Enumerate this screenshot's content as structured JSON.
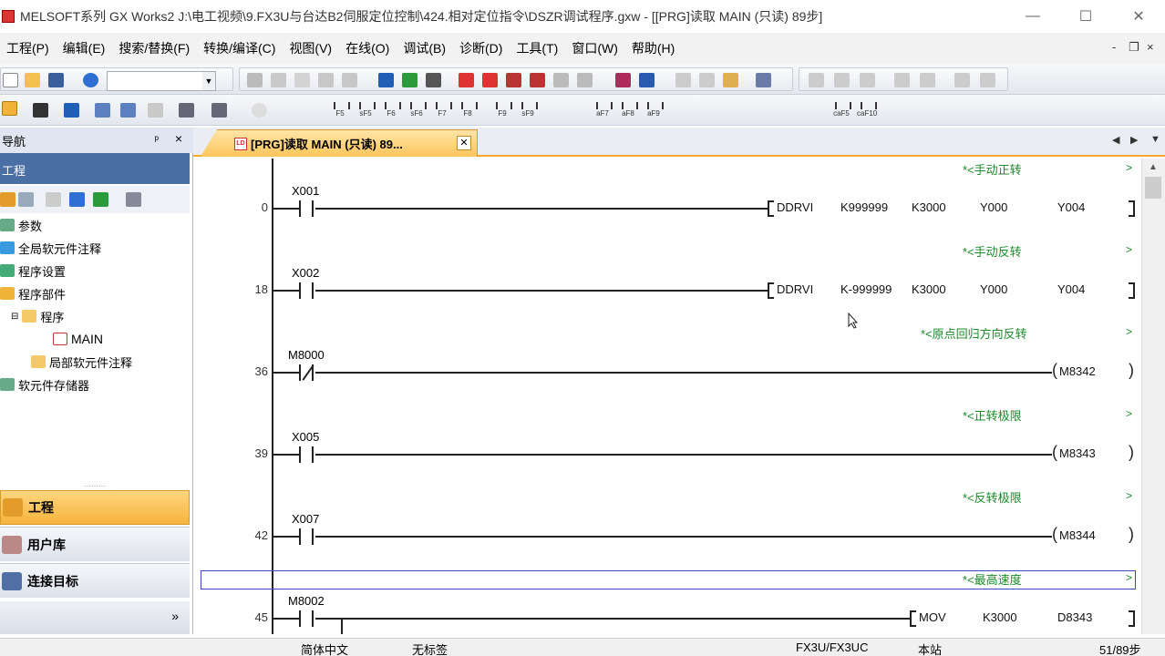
{
  "window": {
    "title": "MELSOFT系列 GX Works2 J:\\电工视频\\9.FX3U与台达B2伺服定位控制\\424.相对定位指令\\DSZR调试程序.gxw - [[PRG]读取 MAIN (只读) 89步]",
    "minimize": "—",
    "maximize": "☐",
    "close": "✕"
  },
  "menu": {
    "items": [
      "工程(P)",
      "编辑(E)",
      "搜索/替换(F)",
      "转换/编译(C)",
      "视图(V)",
      "在线(O)",
      "调试(B)",
      "诊断(D)",
      "工具(T)",
      "窗口(W)",
      "帮助(H)"
    ],
    "mdi_minimize": "-",
    "mdi_restore": "❐",
    "mdi_close": "×"
  },
  "toolbar": {
    "combo_value": "",
    "fkeys": [
      "F5",
      "sF5",
      "F6",
      "sF6",
      "F7",
      "F8",
      "F9",
      "sF9",
      "aF7",
      "aF8",
      "aF9",
      "caF5",
      "caF10"
    ]
  },
  "nav": {
    "header": "导航",
    "pin": "ᵖ",
    "close": "×",
    "section": "工程",
    "tree": [
      {
        "label": "参数",
        "level": 0
      },
      {
        "label": "全局软元件注释",
        "level": 0
      },
      {
        "label": "程序设置",
        "level": 0
      },
      {
        "label": "程序部件",
        "level": 0
      },
      {
        "label": "程序",
        "level": 1
      },
      {
        "label": "MAIN",
        "level": 2
      },
      {
        "label": "局部软元件注释",
        "level": 1
      },
      {
        "label": "软元件存储器",
        "level": 0
      }
    ],
    "buttons": [
      {
        "label": "工程",
        "active": true
      },
      {
        "label": "用户库",
        "active": false
      },
      {
        "label": "连接目标",
        "active": false
      }
    ],
    "bottom": "»",
    "splitter": "·········"
  },
  "tabs": {
    "active_label": "[PRG]读取 MAIN (只读) 89...",
    "close": "✕",
    "prev": "◀",
    "next": "▶",
    "menu": "▼"
  },
  "ladder": {
    "rungs": [
      {
        "step": "0",
        "comment": "*<手动正转",
        "contact": "X001",
        "contact_type": "NO",
        "output": "instruction",
        "instruction": "DDRVI",
        "operands": [
          "K999999",
          "K3000",
          "Y000",
          "Y004"
        ]
      },
      {
        "step": "18",
        "comment": "*<手动反转",
        "contact": "X002",
        "contact_type": "NO",
        "output": "instruction",
        "instruction": "DDRVI",
        "operands": [
          "K-999999",
          "K3000",
          "Y000",
          "Y004"
        ]
      },
      {
        "step": "36",
        "comment": "*<原点回归方向反转",
        "contact": "M8000",
        "contact_type": "NC",
        "output": "coil",
        "coil": "M8342"
      },
      {
        "step": "39",
        "comment": "*<正转极限",
        "contact": "X005",
        "contact_type": "NO",
        "output": "coil",
        "coil": "M8343"
      },
      {
        "step": "42",
        "comment": "*<反转极限",
        "contact": "X007",
        "contact_type": "NO",
        "output": "coil",
        "coil": "M8344"
      },
      {
        "step": "45",
        "comment": "*<最高速度",
        "contact": "M8002",
        "contact_type": "NO",
        "output": "instruction",
        "instruction": "MOV",
        "operands": [
          "K3000",
          "D8343"
        ]
      }
    ],
    "comment_suffix": ">"
  },
  "scrollbar": {
    "up": "▲"
  },
  "status": {
    "language": "简体中文",
    "label": "无标签",
    "cpu": "FX3U/FX3UC",
    "station": "本站",
    "steps": "51/89步"
  }
}
